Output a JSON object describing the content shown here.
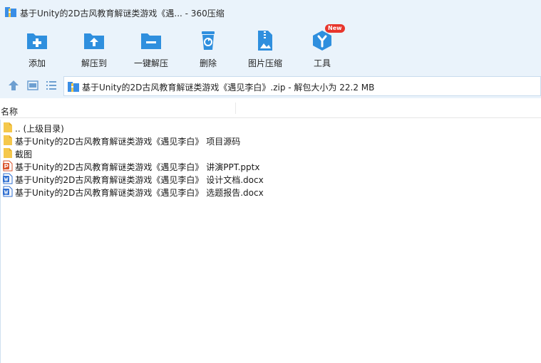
{
  "window": {
    "title": "基于Unity的2D古风教育解谜类游戏《遇... - 360压缩"
  },
  "toolbar": {
    "buttons": [
      {
        "label": "添加",
        "icon": "add-icon"
      },
      {
        "label": "解压到",
        "icon": "extract-to-icon"
      },
      {
        "label": "一键解压",
        "icon": "one-click-extract-icon"
      },
      {
        "label": "删除",
        "icon": "delete-icon"
      },
      {
        "label": "图片压缩",
        "icon": "image-compress-icon"
      },
      {
        "label": "工具",
        "icon": "tools-icon",
        "badge": "New"
      }
    ]
  },
  "nav": {
    "path": "基于Unity的2D古风教育解谜类游戏《遇见李白》.zip - 解包大小为 22.2 MB"
  },
  "list": {
    "column_name": "名称",
    "items": [
      {
        "name": ".. (上级目录)",
        "type": "folder"
      },
      {
        "name": "基于Unity的2D古风教育解谜类游戏《遇见李白》 项目源码",
        "type": "folder"
      },
      {
        "name": "截图",
        "type": "folder"
      },
      {
        "name": "基于Unity的2D古风教育解谜类游戏《遇见李白》 讲演PPT.pptx",
        "type": "pptx"
      },
      {
        "name": "基于Unity的2D古风教育解谜类游戏《遇见李白》 设计文档.docx",
        "type": "docx"
      },
      {
        "name": "基于Unity的2D古风教育解谜类游戏《遇见李白》 选题报告.docx",
        "type": "docx"
      }
    ]
  },
  "colors": {
    "accent": "#2f8fde",
    "chrome_bg": "#eaf3fb",
    "folder": "#f5c84c",
    "ppt": "#d9532c",
    "word": "#2f6fd1",
    "badge": "#e8352c"
  }
}
